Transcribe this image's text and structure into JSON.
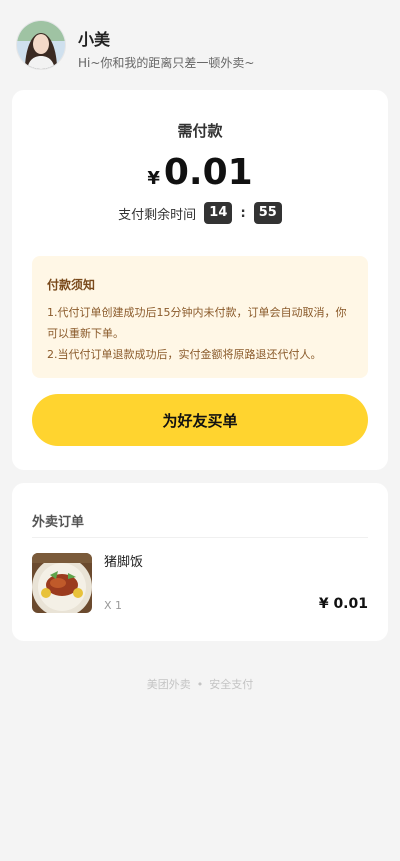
{
  "user": {
    "name": "小美",
    "greeting": "Hi~你和我的距离只差一顿外卖~"
  },
  "payment": {
    "title": "需付款",
    "currency": "¥",
    "amount": "0.01",
    "countdown_label": "支付剩余时间",
    "minutes": "14",
    "separator": ":",
    "seconds": "55"
  },
  "notice": {
    "title": "付款须知",
    "lines": [
      "1.代付订单创建成功后15分钟内未付款，订单会自动取消，你可以重新下单。",
      "2.当代付订单退款成功后，实付金额将原路退还代付人。"
    ]
  },
  "action": {
    "buy_label": "为好友买单"
  },
  "order": {
    "title": "外卖订单",
    "items": [
      {
        "name": "猪脚饭",
        "quantity": "X 1",
        "price": "¥ 0.01"
      }
    ]
  },
  "footer": {
    "left": "美团外卖",
    "dot": "•",
    "right": "安全支付"
  },
  "colors": {
    "accent": "#ffd42f",
    "notice_bg": "#fff7e6",
    "page_bg": "#f4f4f4"
  }
}
